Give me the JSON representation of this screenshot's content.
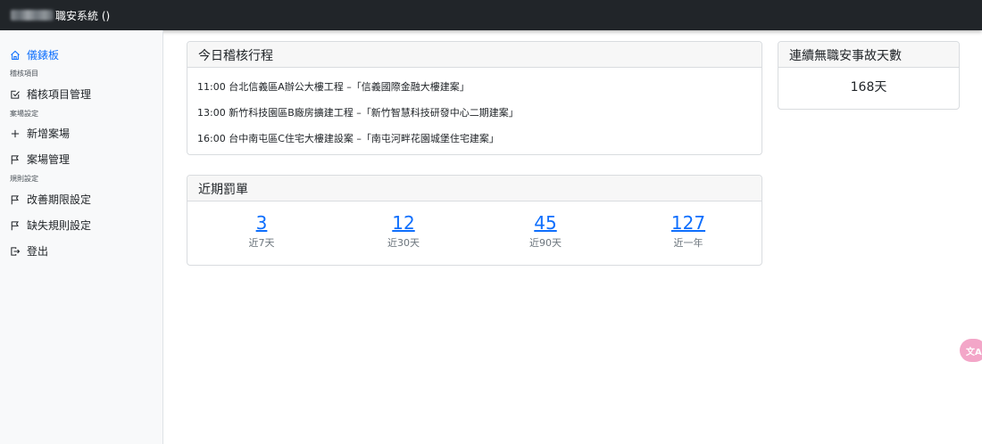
{
  "header": {
    "app_title": "職安系統 ()"
  },
  "sidebar": {
    "dashboard": "儀錶板",
    "section_inspection": "稽核項目",
    "inspection_manage": "稽核項目管理",
    "section_site": "案場設定",
    "add_site": "新增案場",
    "site_manage": "案場管理",
    "section_rules": "規則設定",
    "improve_deadline": "改善期限設定",
    "defect_rules": "缺失規則設定",
    "logout": "登出"
  },
  "schedule": {
    "title": "今日稽核行程",
    "items": [
      "11:00 台北信義區A辦公大樓工程 –「信義國際金融大樓建案」",
      "13:00 新竹科技園區B廠房擴建工程 –「新竹智慧科技研發中心二期建案」",
      "16:00 台中南屯區C住宅大樓建設案 –「南屯河畔花園城堡住宅建案」"
    ]
  },
  "penalties": {
    "title": "近期罰單",
    "items": [
      {
        "count": "3",
        "label": "近7天"
      },
      {
        "count": "12",
        "label": "近30天"
      },
      {
        "count": "45",
        "label": "近90天"
      },
      {
        "count": "127",
        "label": "近一年"
      }
    ]
  },
  "safety": {
    "title": "連續無職安事故天數",
    "days": "168天"
  },
  "colors": {
    "topbar": "#212529",
    "accent": "#0d6efd",
    "sidebar_bg": "#f8f9fa",
    "float_button": "#f3a6c8"
  },
  "icons": {
    "dashboard": "house-icon",
    "inspection": "check-square-icon",
    "add": "plus-icon",
    "site": "flag-icon",
    "logout": "box-arrow-right-icon",
    "floating": "translate-icon"
  }
}
